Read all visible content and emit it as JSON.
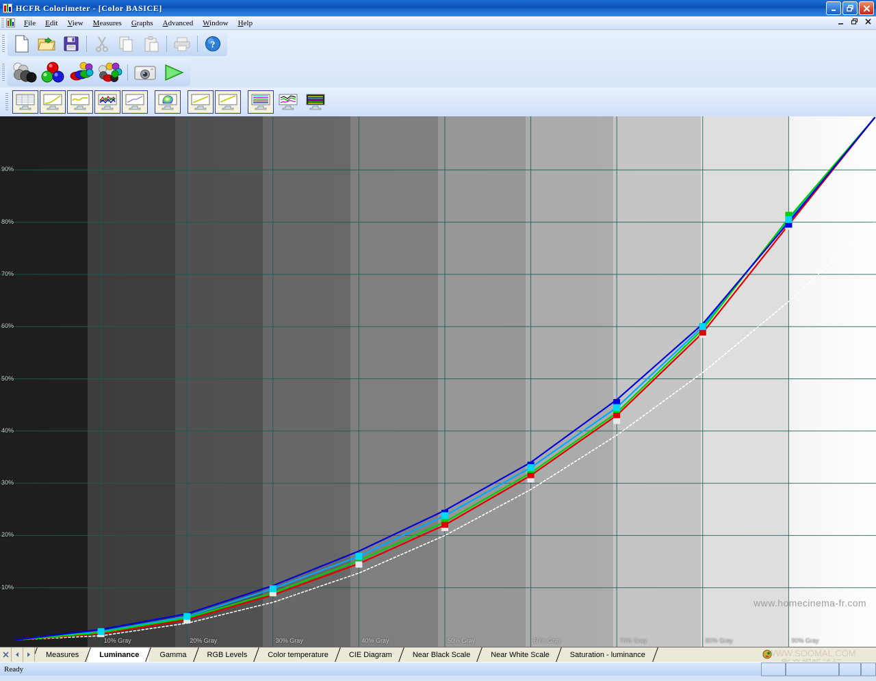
{
  "window": {
    "title": "HCFR Colorimeter - [Color BASICE]",
    "icon": "rgb-bars-icon",
    "buttons": [
      {
        "name": "minimize-button",
        "glyph": "_"
      },
      {
        "name": "restore-button",
        "glyph": "❐"
      },
      {
        "name": "close-button",
        "glyph": "✕"
      }
    ],
    "mdi_buttons": [
      {
        "name": "mdi-minimize-button",
        "glyph": "_"
      },
      {
        "name": "mdi-restore-button",
        "glyph": "❐"
      },
      {
        "name": "mdi-close-button",
        "glyph": "✕"
      }
    ]
  },
  "menubar": {
    "items": [
      {
        "label": "File",
        "accel": "F"
      },
      {
        "label": "Edit",
        "accel": "E"
      },
      {
        "label": "View",
        "accel": "V"
      },
      {
        "label": "Measures",
        "accel": "M"
      },
      {
        "label": "Graphs",
        "accel": "G"
      },
      {
        "label": "Advanced",
        "accel": "A"
      },
      {
        "label": "Window",
        "accel": "W"
      },
      {
        "label": "Help",
        "accel": "H"
      }
    ]
  },
  "toolbar_standard": {
    "buttons": [
      {
        "name": "new-document-button",
        "icon": "new-file-icon"
      },
      {
        "name": "open-document-button",
        "icon": "open-folder-icon"
      },
      {
        "name": "save-document-button",
        "icon": "floppy-save-icon"
      },
      {
        "name": "cut-button",
        "icon": "scissors-icon"
      },
      {
        "name": "copy-button",
        "icon": "copy-pages-icon"
      },
      {
        "name": "paste-button",
        "icon": "clipboard-paste-icon"
      },
      {
        "name": "print-button",
        "icon": "printer-icon"
      },
      {
        "name": "help-button",
        "icon": "question-mark-icon"
      }
    ]
  },
  "toolbar_measures": {
    "buttons": [
      {
        "name": "grayscale-measure-button",
        "icon": "gray-spheres-icon"
      },
      {
        "name": "primaries-measure-button",
        "icon": "rgb-spheres-icon"
      },
      {
        "name": "saturations-measure-button",
        "icon": "color-saturation-icon"
      },
      {
        "name": "full-measure-button",
        "icon": "color-wheel-spheres-icon"
      },
      {
        "name": "single-measure-button",
        "icon": "camera-icon"
      },
      {
        "name": "run-measures-button",
        "icon": "green-play-icon"
      }
    ]
  },
  "toolbar_graphs": {
    "buttons": [
      {
        "name": "graph-measures-button",
        "icon": "monitor-table-icon"
      },
      {
        "name": "graph-luminance-button",
        "icon": "monitor-curve-icon"
      },
      {
        "name": "graph-gamma-button",
        "icon": "monitor-wave-icon"
      },
      {
        "name": "graph-rgb-levels-button",
        "icon": "monitor-multiline-icon"
      },
      {
        "name": "graph-color-temperature-button",
        "icon": "monitor-temp-icon"
      },
      {
        "name": "graph-cie-diagram-button",
        "icon": "monitor-cie-icon"
      },
      {
        "name": "graph-near-black-scale-button",
        "icon": "monitor-nearblack-icon"
      },
      {
        "name": "graph-near-white-scale-button",
        "icon": "monitor-nearwhite-icon"
      },
      {
        "name": "graph-saturation-luminance-button",
        "icon": "monitor-saturation-icon"
      },
      {
        "name": "graph-history-button",
        "icon": "monitor-history-icon"
      },
      {
        "name": "graph-spectrum-button",
        "icon": "monitor-spectrum-icon"
      }
    ]
  },
  "chart_data": {
    "type": "line",
    "title": "",
    "xlabel": "",
    "ylabel": "",
    "xlim": [
      0,
      100
    ],
    "ylim": [
      0,
      100
    ],
    "grid": true,
    "legend": "none",
    "background": "stepped-grayscale-ramp",
    "watermark": "www.homecinema-fr.com",
    "y_ticks": [
      "10%",
      "20%",
      "30%",
      "40%",
      "50%",
      "60%",
      "70%",
      "80%",
      "90%"
    ],
    "y_tick_values": [
      10,
      20,
      30,
      40,
      50,
      60,
      70,
      80,
      90
    ],
    "x_ticks": [
      "10% Gray",
      "20% Gray",
      "30% Gray",
      "40% Gray",
      "50% Gray",
      "60% Gray",
      "70% Gray",
      "80% Gray",
      "90% Gray"
    ],
    "x_tick_values": [
      10,
      20,
      30,
      40,
      50,
      60,
      70,
      80,
      90
    ],
    "x": [
      0,
      10,
      20,
      30,
      40,
      50,
      60,
      70,
      80,
      90,
      100
    ],
    "series": [
      {
        "name": "Reference gamma",
        "color": "#ffffff",
        "style": "dotted",
        "values": [
          0,
          0.8,
          3.2,
          7.2,
          12.8,
          20.0,
          28.8,
          39.2,
          51.2,
          64.8,
          80.0,
          100
        ]
      },
      {
        "name": "Luminance",
        "color": "#00a8ff",
        "style": "solid-marker",
        "marker": "square-cyan",
        "values": [
          0,
          1.6,
          4.5,
          9.8,
          16.0,
          23.8,
          33.0,
          44.5,
          60.0,
          80.5,
          100
        ]
      },
      {
        "name": "Red",
        "color": "#e00000",
        "style": "solid",
        "values": [
          0,
          1.2,
          3.8,
          8.6,
          14.6,
          22.0,
          31.5,
          43.0,
          58.8,
          79.5,
          100
        ]
      },
      {
        "name": "Green",
        "color": "#00d000",
        "style": "solid",
        "values": [
          0,
          1.4,
          4.2,
          9.0,
          15.2,
          22.6,
          32.0,
          43.5,
          59.5,
          80.8,
          100
        ]
      },
      {
        "name": "Blue",
        "color": "#0000d8",
        "style": "solid",
        "values": [
          0,
          2.0,
          5.0,
          10.4,
          17.0,
          24.8,
          34.0,
          46.0,
          60.5,
          80.0,
          100
        ]
      },
      {
        "name": "Measured white",
        "color": "#e8e8e8",
        "style": "marker",
        "marker": "square-white",
        "values": [
          0,
          1.2,
          3.8,
          9.0,
          14.5,
          21.5,
          30.8,
          42.0,
          58.5,
          79.2,
          100
        ]
      }
    ],
    "markers": [
      {
        "x": 10,
        "y": 1.6,
        "color": "#00d8f8"
      },
      {
        "x": 20,
        "y": 4.5,
        "color": "#00d8f8"
      },
      {
        "x": 30,
        "y": 9.8,
        "color": "#00d8f8"
      },
      {
        "x": 40,
        "y": 16.0,
        "color": "#00d8f8"
      },
      {
        "x": 50,
        "y": 23.8,
        "color": "#00d8f8"
      },
      {
        "x": 60,
        "y": 33.0,
        "color": "#00d8f8"
      },
      {
        "x": 70,
        "y": 44.5,
        "color": "#00d8f8"
      },
      {
        "x": 80,
        "y": 60.0,
        "color": "#00d8f8"
      },
      {
        "x": 90,
        "y": 80.5,
        "color": "#00d8f8"
      }
    ]
  },
  "tabbar": {
    "nav": [
      {
        "name": "tab-close-button",
        "glyph": "✕"
      },
      {
        "name": "tab-prev-button",
        "glyph": "◀"
      },
      {
        "name": "tab-next-button",
        "glyph": "▶"
      }
    ],
    "tabs": [
      {
        "label": "Measures",
        "active": false
      },
      {
        "label": "Luminance",
        "active": true
      },
      {
        "label": "Gamma",
        "active": false
      },
      {
        "label": "RGB Levels",
        "active": false
      },
      {
        "label": "Color temperature",
        "active": false
      },
      {
        "label": "CIE Diagram",
        "active": false
      },
      {
        "label": "Near Black Scale",
        "active": false
      },
      {
        "label": "Near White Scale",
        "active": false
      },
      {
        "label": "Saturation - luminance",
        "active": false
      }
    ]
  },
  "statusbar": {
    "text": "Ready"
  }
}
